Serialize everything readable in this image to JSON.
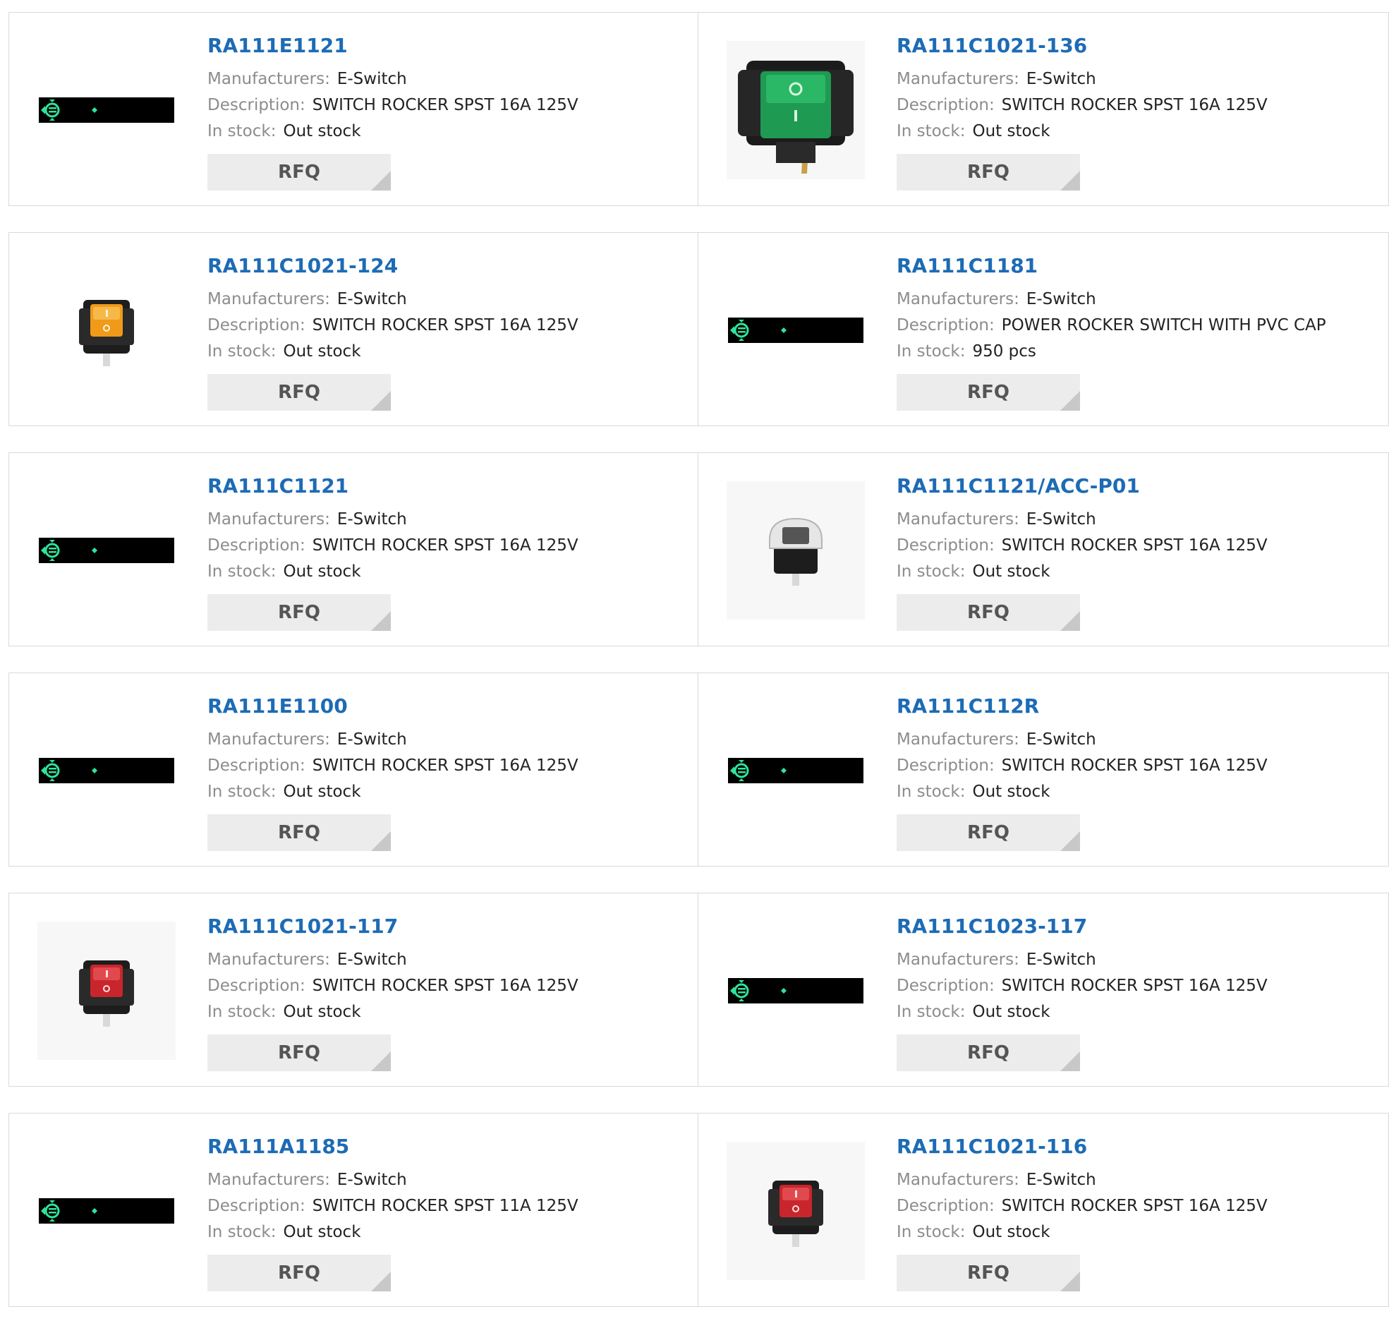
{
  "labels": {
    "manufacturer": "Manufacturers:",
    "description": "Description:",
    "stock": "In stock:",
    "rfq": "RFQ"
  },
  "colors": {
    "link": "#1d6bb5",
    "label": "#8c8c8c",
    "button_bg": "#ececec"
  },
  "products": [
    {
      "part": "RA111E1121",
      "manufacturer": "E-Switch",
      "description": "SWITCH ROCKER SPST 16A 125V",
      "stock": "Out stock",
      "image": "placeholder"
    },
    {
      "part": "RA111C1021-136",
      "manufacturer": "E-Switch",
      "description": "SWITCH ROCKER SPST 16A 125V",
      "stock": "Out stock",
      "image": "green-rocker-switch"
    },
    {
      "part": "RA111C1021-124",
      "manufacturer": "E-Switch",
      "description": "SWITCH ROCKER SPST 16A 125V",
      "stock": "Out stock",
      "image": "amber-rocker-switch"
    },
    {
      "part": "RA111C1181",
      "manufacturer": "E-Switch",
      "description": "POWER ROCKER SWITCH WITH PVC CAP",
      "stock": "950 pcs",
      "image": "placeholder"
    },
    {
      "part": "RA111C1121",
      "manufacturer": "E-Switch",
      "description": "SWITCH ROCKER SPST 16A 125V",
      "stock": "Out stock",
      "image": "placeholder"
    },
    {
      "part": "RA111C1121/ACC-P01",
      "manufacturer": "E-Switch",
      "description": "SWITCH ROCKER SPST 16A 125V",
      "stock": "Out stock",
      "image": "capped-rocker-switch"
    },
    {
      "part": "RA111E1100",
      "manufacturer": "E-Switch",
      "description": "SWITCH ROCKER SPST 16A 125V",
      "stock": "Out stock",
      "image": "placeholder"
    },
    {
      "part": "RA111C112R",
      "manufacturer": "E-Switch",
      "description": "SWITCH ROCKER SPST 16A 125V",
      "stock": "Out stock",
      "image": "placeholder"
    },
    {
      "part": "RA111C1021-117",
      "manufacturer": "E-Switch",
      "description": "SWITCH ROCKER SPST 16A 125V",
      "stock": "Out stock",
      "image": "red-rocker-switch"
    },
    {
      "part": "RA111C1023-117",
      "manufacturer": "E-Switch",
      "description": "SWITCH ROCKER SPST 16A 125V",
      "stock": "Out stock",
      "image": "placeholder"
    },
    {
      "part": "RA111A1185",
      "manufacturer": "E-Switch",
      "description": "SWITCH ROCKER SPST 11A 125V",
      "stock": "Out stock",
      "image": "placeholder"
    },
    {
      "part": "RA111C1021-116",
      "manufacturer": "E-Switch",
      "description": "SWITCH ROCKER SPST 16A 125V",
      "stock": "Out stock",
      "image": "red-rocker-switch"
    }
  ]
}
